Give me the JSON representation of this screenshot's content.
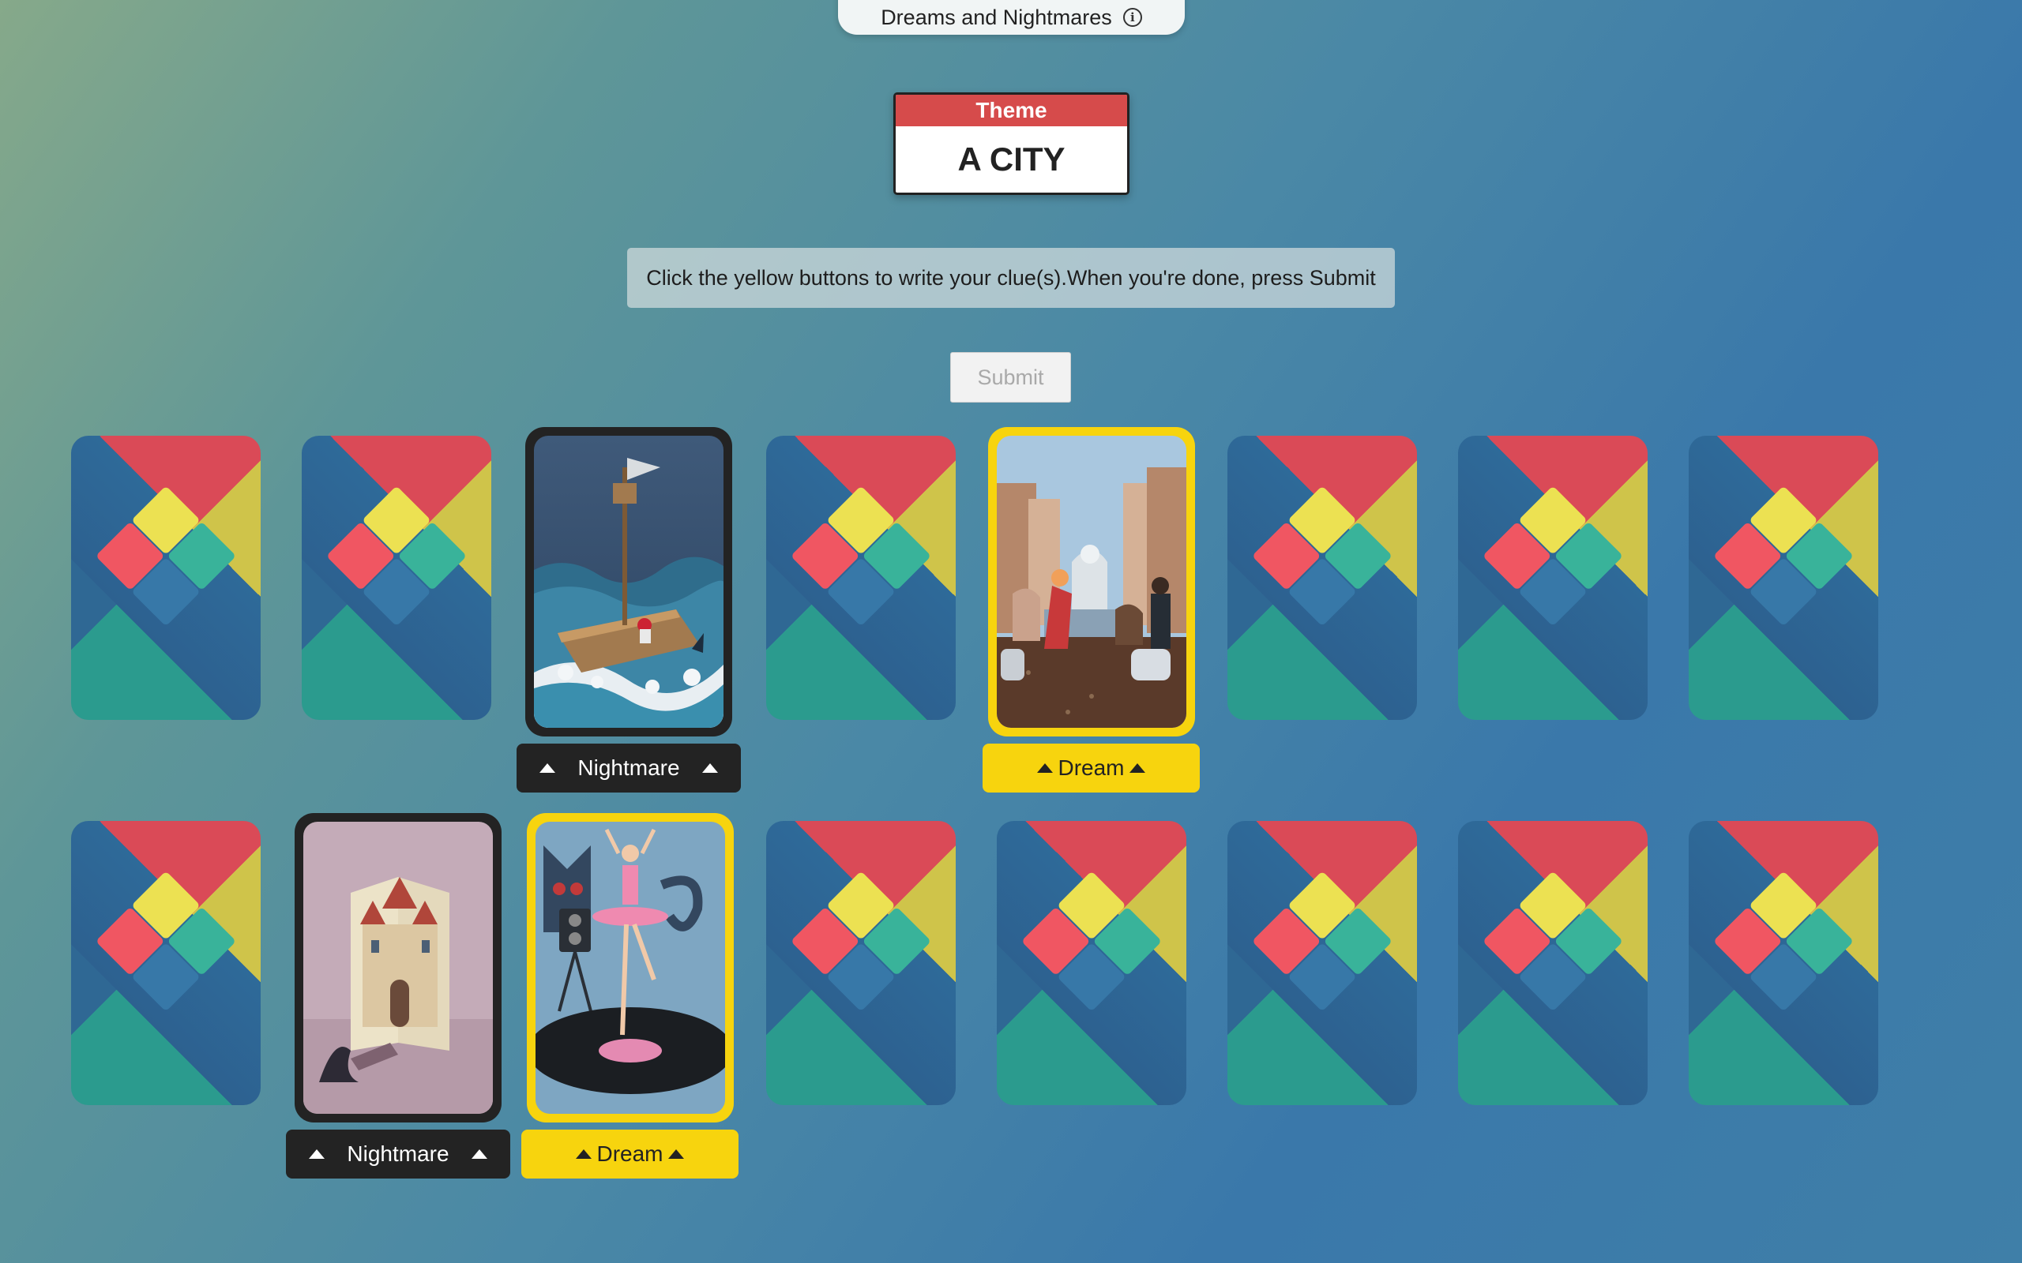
{
  "header": {
    "title": "Dreams and Nightmares",
    "info_icon": "info-circle-icon"
  },
  "theme": {
    "label": "Theme",
    "value": "A CITY",
    "header_color": "#d64b4b"
  },
  "instruction": "Click the yellow buttons to write your clue(s).When you're done, press Submit",
  "submit": {
    "label": "Submit",
    "disabled": true
  },
  "colors": {
    "nightmare": "#232323",
    "dream": "#f7d40e"
  },
  "cards": {
    "row1": [
      {
        "state": "face-down"
      },
      {
        "state": "face-down"
      },
      {
        "state": "face-up",
        "tag": "nightmare",
        "icon": "raft-in-stormy-sea-illustration",
        "tag_label": "Nightmare"
      },
      {
        "state": "face-down"
      },
      {
        "state": "face-up",
        "tag": "dream",
        "icon": "city-plaza-with-statue-illustration",
        "tag_label": "Dream"
      },
      {
        "state": "face-down"
      },
      {
        "state": "face-down"
      },
      {
        "state": "face-down"
      }
    ],
    "row2": [
      {
        "state": "face-down"
      },
      {
        "state": "face-up",
        "tag": "nightmare",
        "icon": "castle-in-open-book-illustration",
        "tag_label": "Nightmare"
      },
      {
        "state": "face-up",
        "tag": "dream",
        "icon": "ballerina-on-record-illustration",
        "tag_label": "Dream"
      },
      {
        "state": "face-down"
      },
      {
        "state": "face-down"
      },
      {
        "state": "face-down"
      },
      {
        "state": "face-down"
      },
      {
        "state": "face-down"
      }
    ]
  }
}
